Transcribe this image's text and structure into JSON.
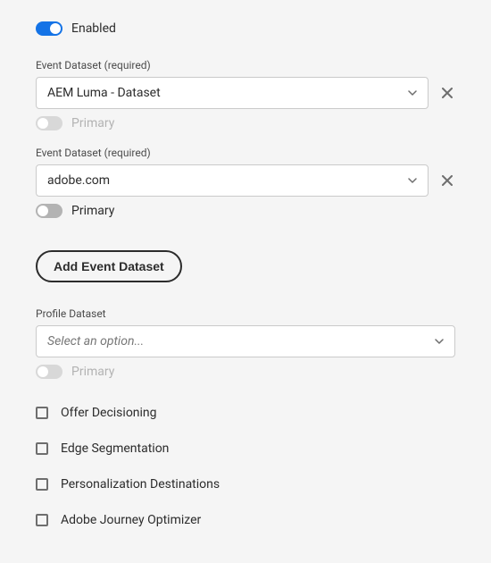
{
  "enabled": {
    "label": "Enabled",
    "on": true
  },
  "eventDatasets": [
    {
      "label": "Event Dataset (required)",
      "value": "AEM Luma - Dataset",
      "primaryLabel": "Primary",
      "primaryOn": false,
      "primaryDisabled": true
    },
    {
      "label": "Event Dataset (required)",
      "value": "adobe.com",
      "primaryLabel": "Primary",
      "primaryOn": false,
      "primaryDisabled": false
    }
  ],
  "addButton": {
    "label": "Add Event Dataset"
  },
  "profileDataset": {
    "label": "Profile Dataset",
    "placeholder": "Select an option...",
    "primaryLabel": "Primary",
    "primaryDisabled": true
  },
  "checkboxes": [
    {
      "label": "Offer Decisioning",
      "checked": false
    },
    {
      "label": "Edge Segmentation",
      "checked": false
    },
    {
      "label": "Personalization Destinations",
      "checked": false
    },
    {
      "label": "Adobe Journey Optimizer",
      "checked": false
    }
  ]
}
